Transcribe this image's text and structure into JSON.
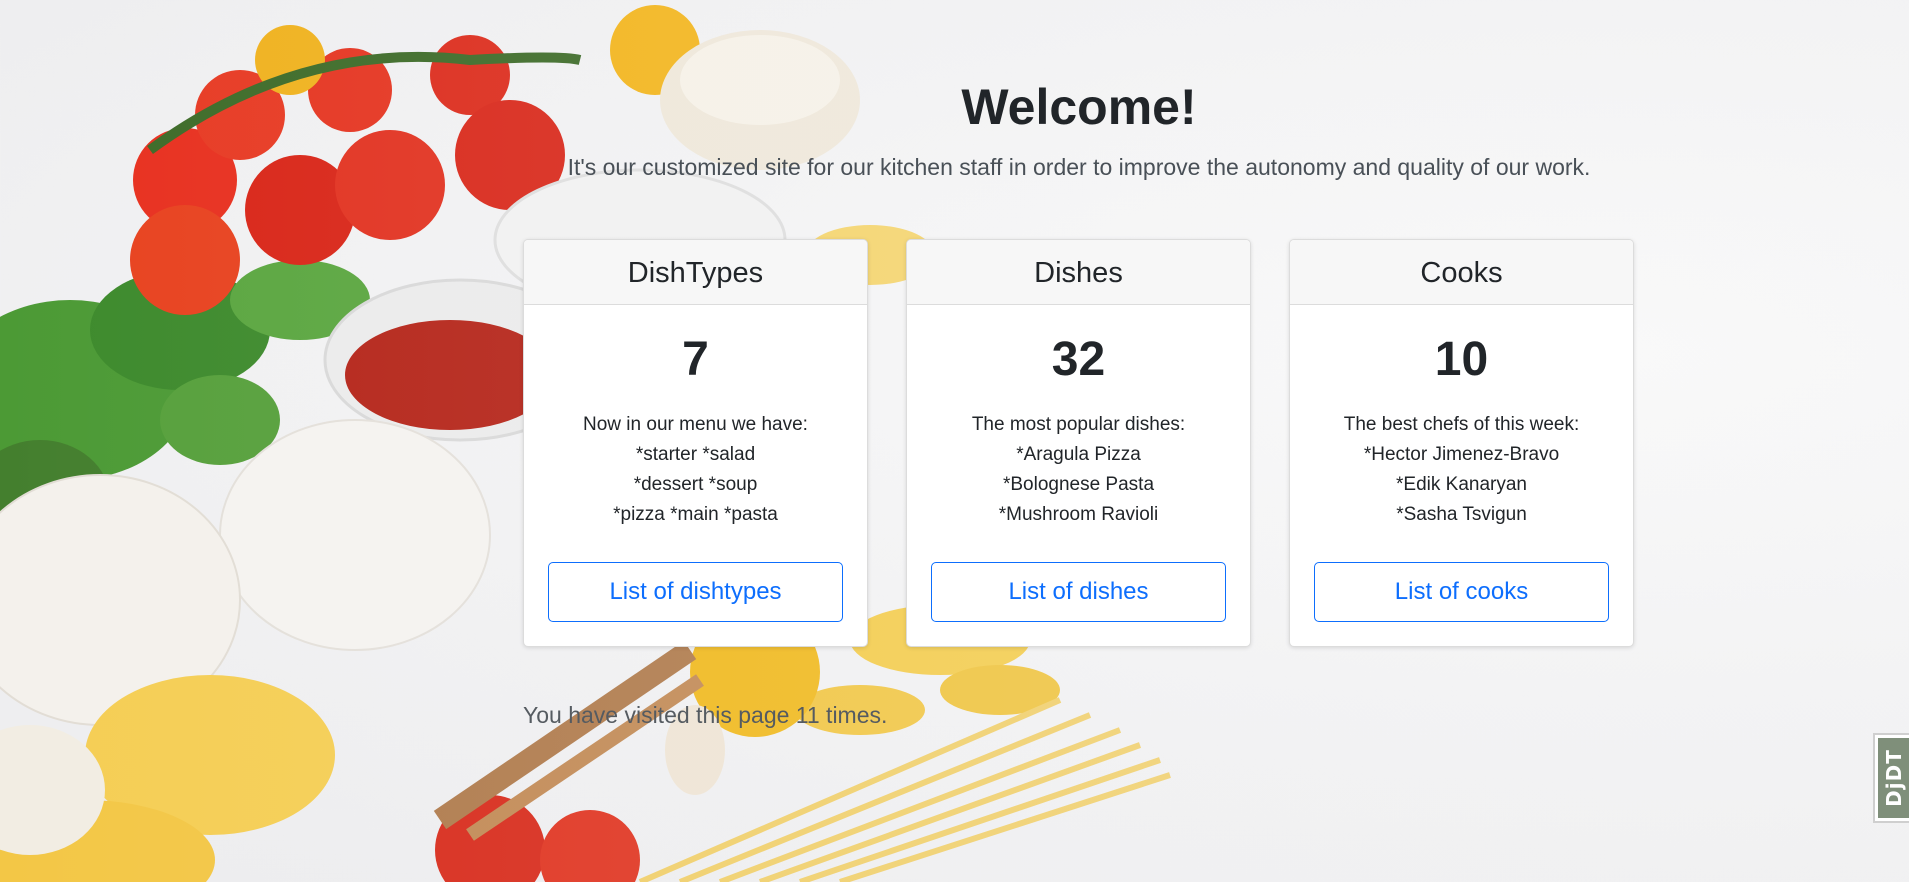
{
  "page": {
    "title": "Welcome!",
    "subtitle": "It's our customized site for our kitchen staff in order to improve the autonomy and quality of our work.",
    "visits_text": "You have visited this page 11 times."
  },
  "cards": [
    {
      "header": "DishTypes",
      "count": "7",
      "lines": [
        "Now in our menu we have:",
        "*starter *salad",
        "*dessert *soup",
        "*pizza *main *pasta"
      ],
      "button_label": "List of dishtypes"
    },
    {
      "header": "Dishes",
      "count": "32",
      "lines": [
        "The most popular dishes:",
        "*Aragula Pizza",
        "*Bolognese Pasta",
        "*Mushroom Ravioli"
      ],
      "button_label": "List of dishes"
    },
    {
      "header": "Cooks",
      "count": "10",
      "lines": [
        "The best chefs of this week:",
        "*Hector Jimenez-Bravo",
        "*Edik Kanaryan",
        "*Sasha Tsvigun"
      ],
      "button_label": "List of cooks"
    }
  ],
  "debug_toolbar": {
    "label": "DjDT"
  },
  "colors": {
    "accent": "#0d6efd",
    "card_header_bg": "#f7f7f7",
    "text": "#212529"
  }
}
